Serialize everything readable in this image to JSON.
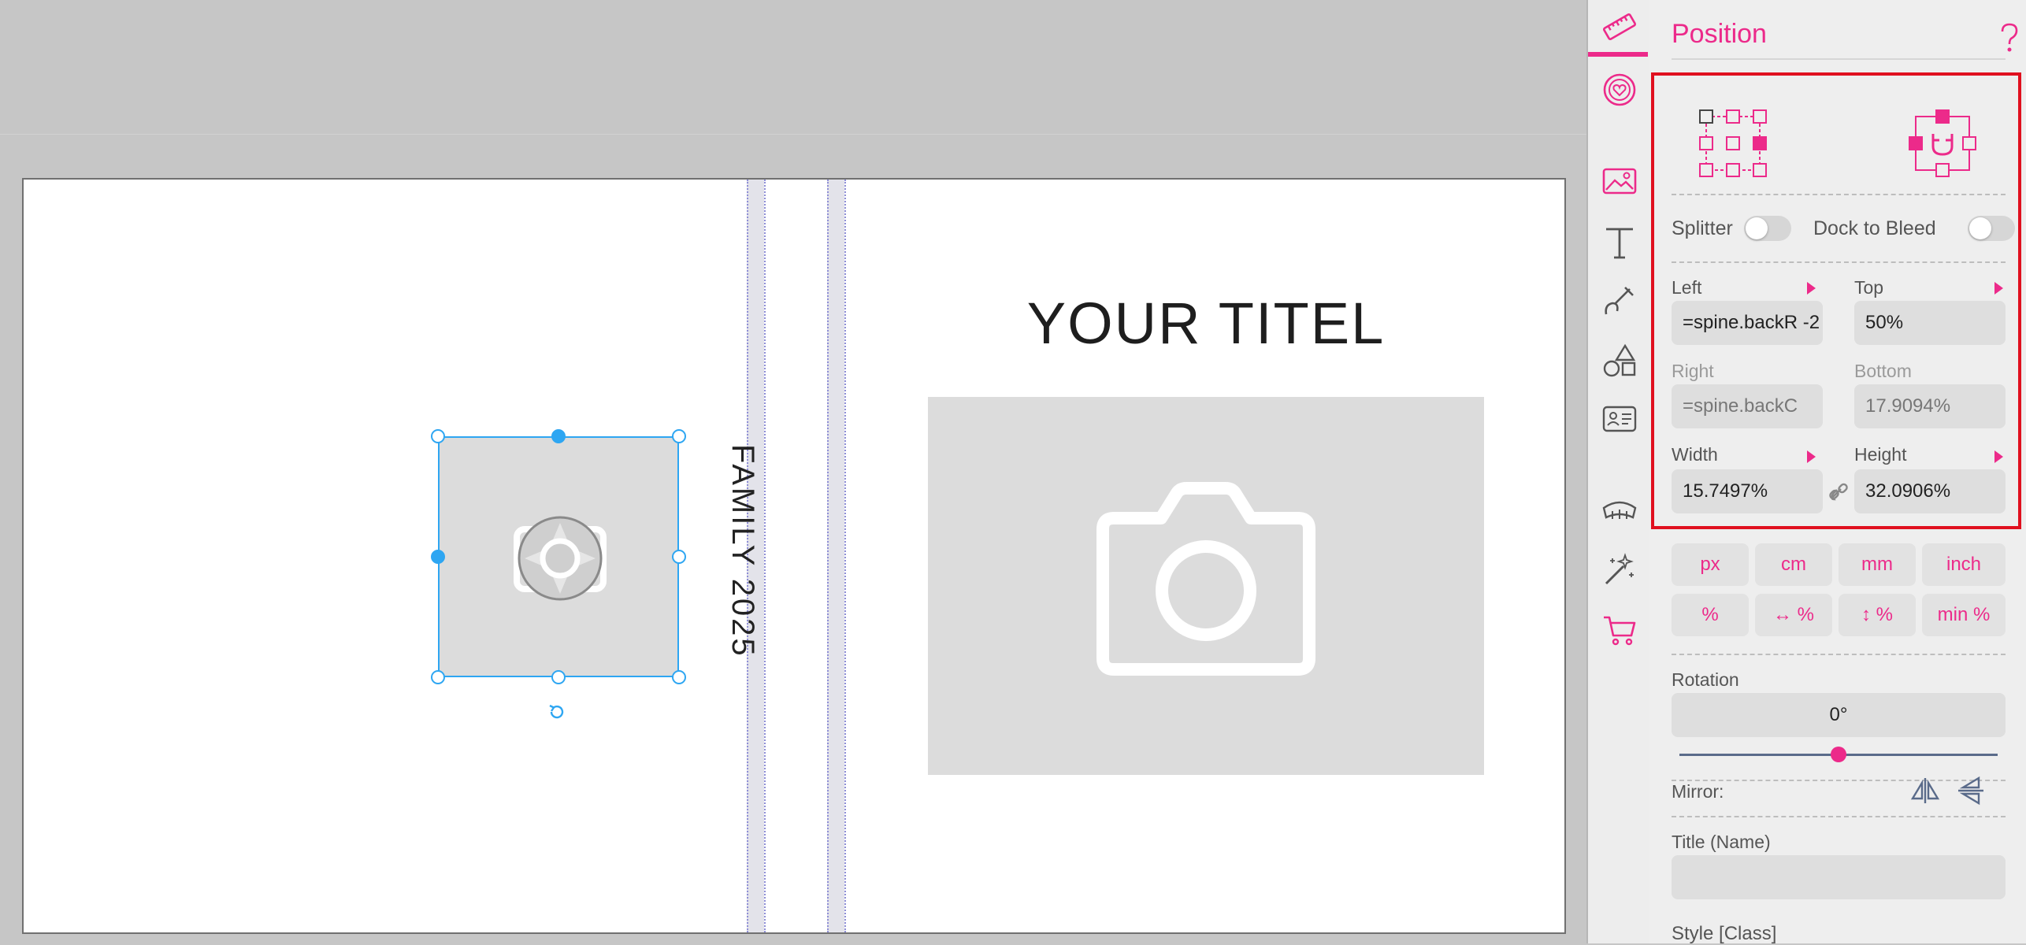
{
  "canvas": {
    "cover_title": "YOUR TITEL",
    "spine_text": "FAMILY 2025"
  },
  "sidebar": {
    "items": [
      {
        "name": "ruler-icon",
        "active": true
      },
      {
        "name": "heart-badge-icon"
      },
      {
        "name": "image-icon"
      },
      {
        "name": "text-icon"
      },
      {
        "name": "brush-icon"
      },
      {
        "name": "shapes-icon"
      },
      {
        "name": "id-card-icon"
      },
      {
        "name": "sketch-icon"
      },
      {
        "name": "magic-wand-icon"
      },
      {
        "name": "cart-icon"
      }
    ]
  },
  "panel": {
    "title": "Position",
    "help_icon": "question-icon",
    "splitter_label": "Splitter",
    "dock_label": "Dock to Bleed",
    "left_label": "Left",
    "left_value": "=spine.backR -2",
    "top_label": "Top",
    "top_value": "50%",
    "right_label": "Right",
    "right_value": "=spine.backC",
    "bottom_label": "Bottom",
    "bottom_value": "17.9094%",
    "width_label": "Width",
    "width_value": "15.7497%",
    "height_label": "Height",
    "height_value": "32.0906%",
    "units": [
      "px",
      "cm",
      "mm",
      "inch",
      "%",
      "↔ %",
      "↕ %",
      "min %"
    ],
    "rotation_label": "Rotation",
    "rotation_value": "0°",
    "rotation_slider": 0.5,
    "mirror_label": "Mirror:",
    "title_name_label": "Title (Name)",
    "title_name_value": "",
    "style_label": "Style [Class]"
  },
  "colors": {
    "accent": "#ec2a8a",
    "selection": "#2ea6f2",
    "highlight_border": "#e0101f"
  }
}
